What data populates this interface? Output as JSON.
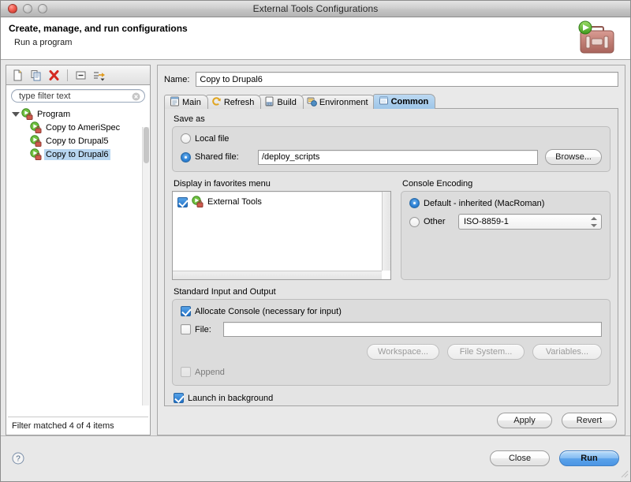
{
  "window": {
    "title": "External Tools Configurations",
    "controls": [
      "close",
      "minimize",
      "zoom"
    ]
  },
  "header": {
    "title": "Create, manage, and run configurations",
    "subtitle": "Run a program",
    "icon": "external-tools-briefcase-icon"
  },
  "left_panel": {
    "toolbar": [
      {
        "name": "new-launch-configuration",
        "icon": "new-document-icon"
      },
      {
        "name": "duplicate-launch-configuration",
        "icon": "copy-icon"
      },
      {
        "name": "delete-launch-configuration",
        "icon": "delete-x-icon"
      },
      {
        "name": "collapse-all",
        "icon": "collapse-all-icon"
      },
      {
        "name": "filter-configurations",
        "icon": "filter-arrow-icon"
      }
    ],
    "filter": {
      "value": "type filter text",
      "placeholder": "type filter text",
      "clear_icon": "clear-circle-icon"
    },
    "tree": [
      {
        "label": "Program",
        "level": 0,
        "expanded": true,
        "selected": false,
        "icon": "program-run-icon"
      },
      {
        "label": "Copy to AmeriSpec",
        "level": 1,
        "expanded": false,
        "selected": false,
        "icon": "program-run-icon"
      },
      {
        "label": "Copy to Drupal5",
        "level": 1,
        "expanded": false,
        "selected": false,
        "icon": "program-run-icon"
      },
      {
        "label": "Copy to Drupal6",
        "level": 1,
        "expanded": false,
        "selected": true,
        "icon": "program-run-icon"
      }
    ],
    "status": "Filter matched 4 of 4 items"
  },
  "right_panel": {
    "name_label": "Name:",
    "name_value": "Copy to Drupal6",
    "tabs": [
      {
        "label": "Main",
        "icon": "main-tab-icon",
        "active": false
      },
      {
        "label": "Refresh",
        "icon": "refresh-tab-icon",
        "active": false
      },
      {
        "label": "Build",
        "icon": "build-tab-icon",
        "active": false
      },
      {
        "label": "Environment",
        "icon": "environment-tab-icon",
        "active": false
      },
      {
        "label": "Common",
        "icon": "common-tab-icon",
        "active": true
      }
    ],
    "save_as": {
      "group_title": "Save as",
      "local_file_label": "Local file",
      "local_file_selected": false,
      "shared_file_label": "Shared file:",
      "shared_file_selected": true,
      "shared_file_value": "/deploy_scripts",
      "browse_label": "Browse..."
    },
    "favorites": {
      "group_title": "Display in favorites menu",
      "items": [
        {
          "label": "External Tools",
          "checked": true,
          "icon": "program-run-icon"
        }
      ]
    },
    "console_encoding": {
      "group_title": "Console Encoding",
      "default_label": "Default - inherited (MacRoman)",
      "default_selected": true,
      "other_label": "Other",
      "other_selected": false,
      "other_value": "ISO-8859-1"
    },
    "std_io": {
      "group_title": "Standard Input and Output",
      "allocate_console_label": "Allocate Console (necessary for input)",
      "allocate_console_checked": true,
      "file_label": "File:",
      "file_checked": false,
      "file_value": "",
      "workspace_label": "Workspace...",
      "file_system_label": "File System...",
      "variables_label": "Variables...",
      "append_label": "Append",
      "append_checked": false,
      "append_enabled": false
    },
    "launch_in_background": {
      "label": "Launch in background",
      "checked": true
    },
    "apply_label": "Apply",
    "revert_label": "Revert"
  },
  "footer": {
    "help_icon": "help-question-icon",
    "close_label": "Close",
    "run_label": "Run",
    "resize_grip": "resize-grip-icon"
  },
  "colors": {
    "selection_blue": "#b8d6f0",
    "active_tab_blue": "#9dc5e8",
    "primary_button_blue": "#5ba3ea",
    "window_chrome": "#e8e8e8",
    "group_box": "#dcdcdc"
  }
}
